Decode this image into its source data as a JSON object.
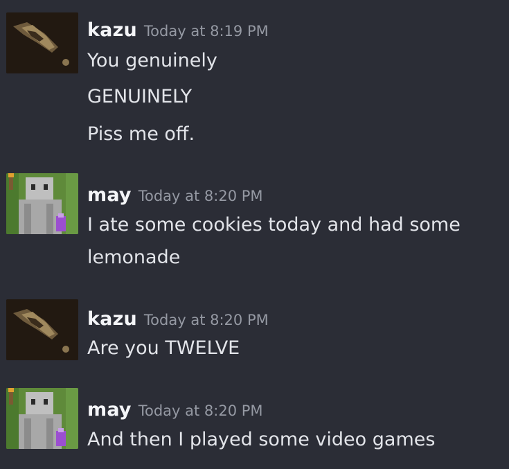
{
  "messages": [
    {
      "author": "kazu",
      "timestamp": "Today at 8:19 PM",
      "avatar_icon": "dark-creature-icon",
      "lines": [
        "You genuinely",
        "GENUINELY",
        "Piss me off."
      ]
    },
    {
      "author": "may",
      "timestamp": "Today at 8:20 PM",
      "avatar_icon": "minecraft-villager-icon",
      "lines": [
        "I ate some cookies today and had some",
        "lemonade"
      ]
    },
    {
      "author": "kazu",
      "timestamp": "Today at 8:20 PM",
      "avatar_icon": "dark-creature-icon",
      "lines": [
        "Are you TWELVE"
      ]
    },
    {
      "author": "may",
      "timestamp": "Today at 8:20 PM",
      "avatar_icon": "minecraft-villager-icon",
      "lines": [
        "And then I played some video games"
      ]
    }
  ],
  "colors": {
    "background": "#2b2d36",
    "username": "#f4f5f8",
    "timestamp": "#9599a3",
    "message_text": "#e2e4e9"
  }
}
